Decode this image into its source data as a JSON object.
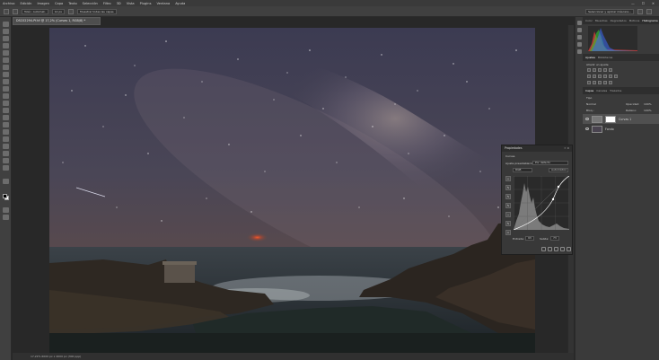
{
  "menu": {
    "items": [
      "Archivo",
      "Edición",
      "Imagen",
      "Capa",
      "Texto",
      "Selección",
      "Filtro",
      "3D",
      "Vista",
      "Plugins",
      "Ventana",
      "Ayuda"
    ],
    "window_controls": [
      "—",
      "☐",
      "✕"
    ]
  },
  "options_bar": {
    "tool_label": "Tolér.: Automat.",
    "size_label": "12 px",
    "refine_label": "Muestrar todas las capas",
    "right_label": "Seleccionar y aplicar máscara..."
  },
  "document": {
    "tab_label": "DSC02294-Pf.tif @ 17,2% (Curvas 1, RGB/8) *",
    "status": "17,22%    6000 px x 4000 px (300 ppp)"
  },
  "panels": {
    "top_tabs": [
      "Color",
      "Muestras",
      "Degradados",
      "Motivos",
      "Histograma"
    ],
    "top_active": "Histograma",
    "adjust_tabs": [
      "Ajustes",
      "Bibliotecas"
    ],
    "adjust_label": "Añadir un ajuste",
    "layer_tabs": [
      "Capas",
      "Canales",
      "Trazados"
    ],
    "layer_kind": "Tipo",
    "blend_mode": "Normal",
    "opacity_label": "Opacidad:",
    "opacity_value": "100%",
    "lock_label": "Bloq.:",
    "fill_label": "Relleno:",
    "fill_value": "100%",
    "layers": [
      {
        "name": "Curvas 1",
        "selected": true
      },
      {
        "name": "Fondo",
        "selected": false
      }
    ]
  },
  "properties": {
    "title": "Propiedades",
    "close": "»  ≡",
    "section": "Curvas",
    "preset_label": "Ajuste preestablecido:",
    "preset_value": "Por defecto",
    "channel": "RGB",
    "auto_button": "Automático",
    "input_label": "Entrada:",
    "input_value": "93",
    "output_label": "Salida:",
    "output_value": "73",
    "tools": [
      "⊹",
      "✎",
      "✎",
      "✎",
      "~",
      "✎",
      "⚠"
    ]
  },
  "colors": {
    "foreground": "#000000",
    "background": "#ffffff",
    "panel": "#3a3a3a",
    "histogram_red": "#e03a3a",
    "histogram_green": "#32c832",
    "histogram_blue": "#3a64e6"
  }
}
